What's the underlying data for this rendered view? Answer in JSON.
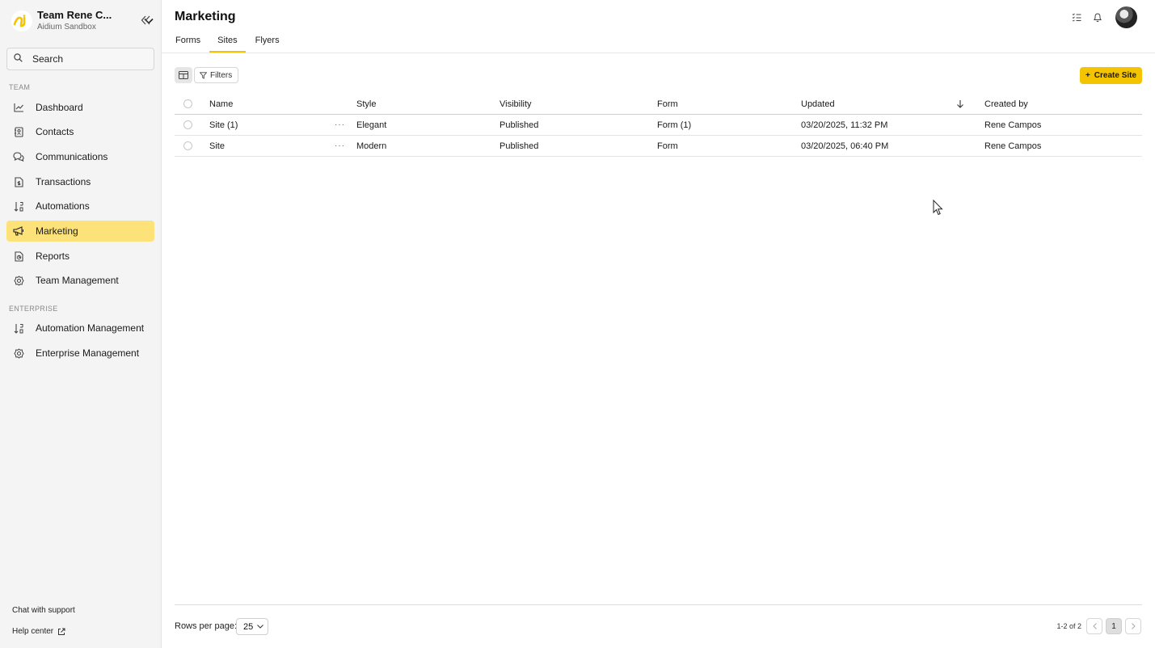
{
  "sidebar": {
    "team_name": "Team Rene C...",
    "team_sub": "Aidium Sandbox",
    "search_placeholder": "Search",
    "team_section": "TEAM",
    "team_items": [
      {
        "label": "Dashboard",
        "icon": "chart-line-icon"
      },
      {
        "label": "Contacts",
        "icon": "contacts-book-icon"
      },
      {
        "label": "Communications",
        "icon": "chat-bubbles-icon"
      },
      {
        "label": "Transactions",
        "icon": "document-dollar-icon"
      },
      {
        "label": "Automations",
        "icon": "sort-numeric-icon"
      },
      {
        "label": "Marketing",
        "icon": "megaphone-icon",
        "active": true
      },
      {
        "label": "Reports",
        "icon": "report-document-icon"
      },
      {
        "label": "Team Management",
        "icon": "gear-icon"
      }
    ],
    "enterprise_section": "ENTERPRISE",
    "enterprise_items": [
      {
        "label": "Automation Management",
        "icon": "sort-numeric-icon"
      },
      {
        "label": "Enterprise Management",
        "icon": "gear-icon"
      }
    ],
    "chat_support": "Chat with support",
    "help_center": "Help center"
  },
  "header": {
    "title": "Marketing",
    "tabs": [
      "Forms",
      "Sites",
      "Flyers"
    ],
    "active_tab": "Sites"
  },
  "toolbar": {
    "filters_label": "Filters",
    "create_label": "Create Site"
  },
  "table": {
    "columns": [
      "Name",
      "Style",
      "Visibility",
      "Form",
      "Updated",
      "Created by"
    ],
    "sort_column": "Updated",
    "rows": [
      {
        "name": "Site (1)",
        "style": "Elegant",
        "visibility": "Published",
        "form": "Form (1)",
        "updated": "03/20/2025, 11:32 PM",
        "created_by": "Rene Campos"
      },
      {
        "name": "Site",
        "style": "Modern",
        "visibility": "Published",
        "form": "Form",
        "updated": "03/20/2025, 06:40 PM",
        "created_by": "Rene Campos"
      }
    ]
  },
  "footer": {
    "rows_per_page_label": "Rows per page:",
    "rows_per_page_value": "25",
    "range_text": "1-2 of 2",
    "current_page": "1"
  },
  "colors": {
    "accent": "#f5c400",
    "active_nav": "#fde27a",
    "sidebar_bg": "#f4f4f4"
  }
}
